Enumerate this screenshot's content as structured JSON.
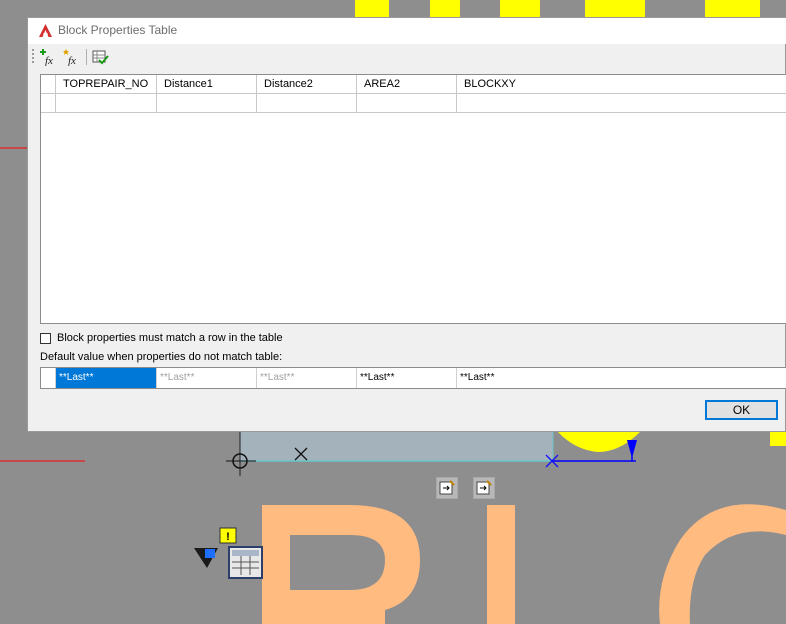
{
  "dialog": {
    "title": "Block Properties Table",
    "toolbar": {
      "add_property_icon": "add-property-fx-icon",
      "new_property_icon": "new-user-parameter-fx-icon",
      "audit_icon": "audit-check-icon"
    },
    "table": {
      "columns": [
        "TOPREPAIR_NO",
        "Distance1",
        "Distance2",
        "AREA2",
        "BLOCKXY"
      ],
      "rows": [
        [
          "",
          "",
          "",
          "",
          ""
        ]
      ]
    },
    "match_checkbox_label": "Block properties must match a row in the table",
    "default_label": "Default value when properties do not match table:",
    "defaults": [
      "**Last**",
      "**Last**",
      "**Last**",
      "**Last**",
      "**Last**"
    ],
    "ok_label": "OK"
  },
  "canvas": {
    "warning_badge": "!",
    "colors": {
      "background": "#8e8e8e",
      "text_yellow": "#ffff00",
      "text_orange": "#ffbb80",
      "accent_blue": "#0000ff",
      "red_line": "#ff0000"
    }
  }
}
